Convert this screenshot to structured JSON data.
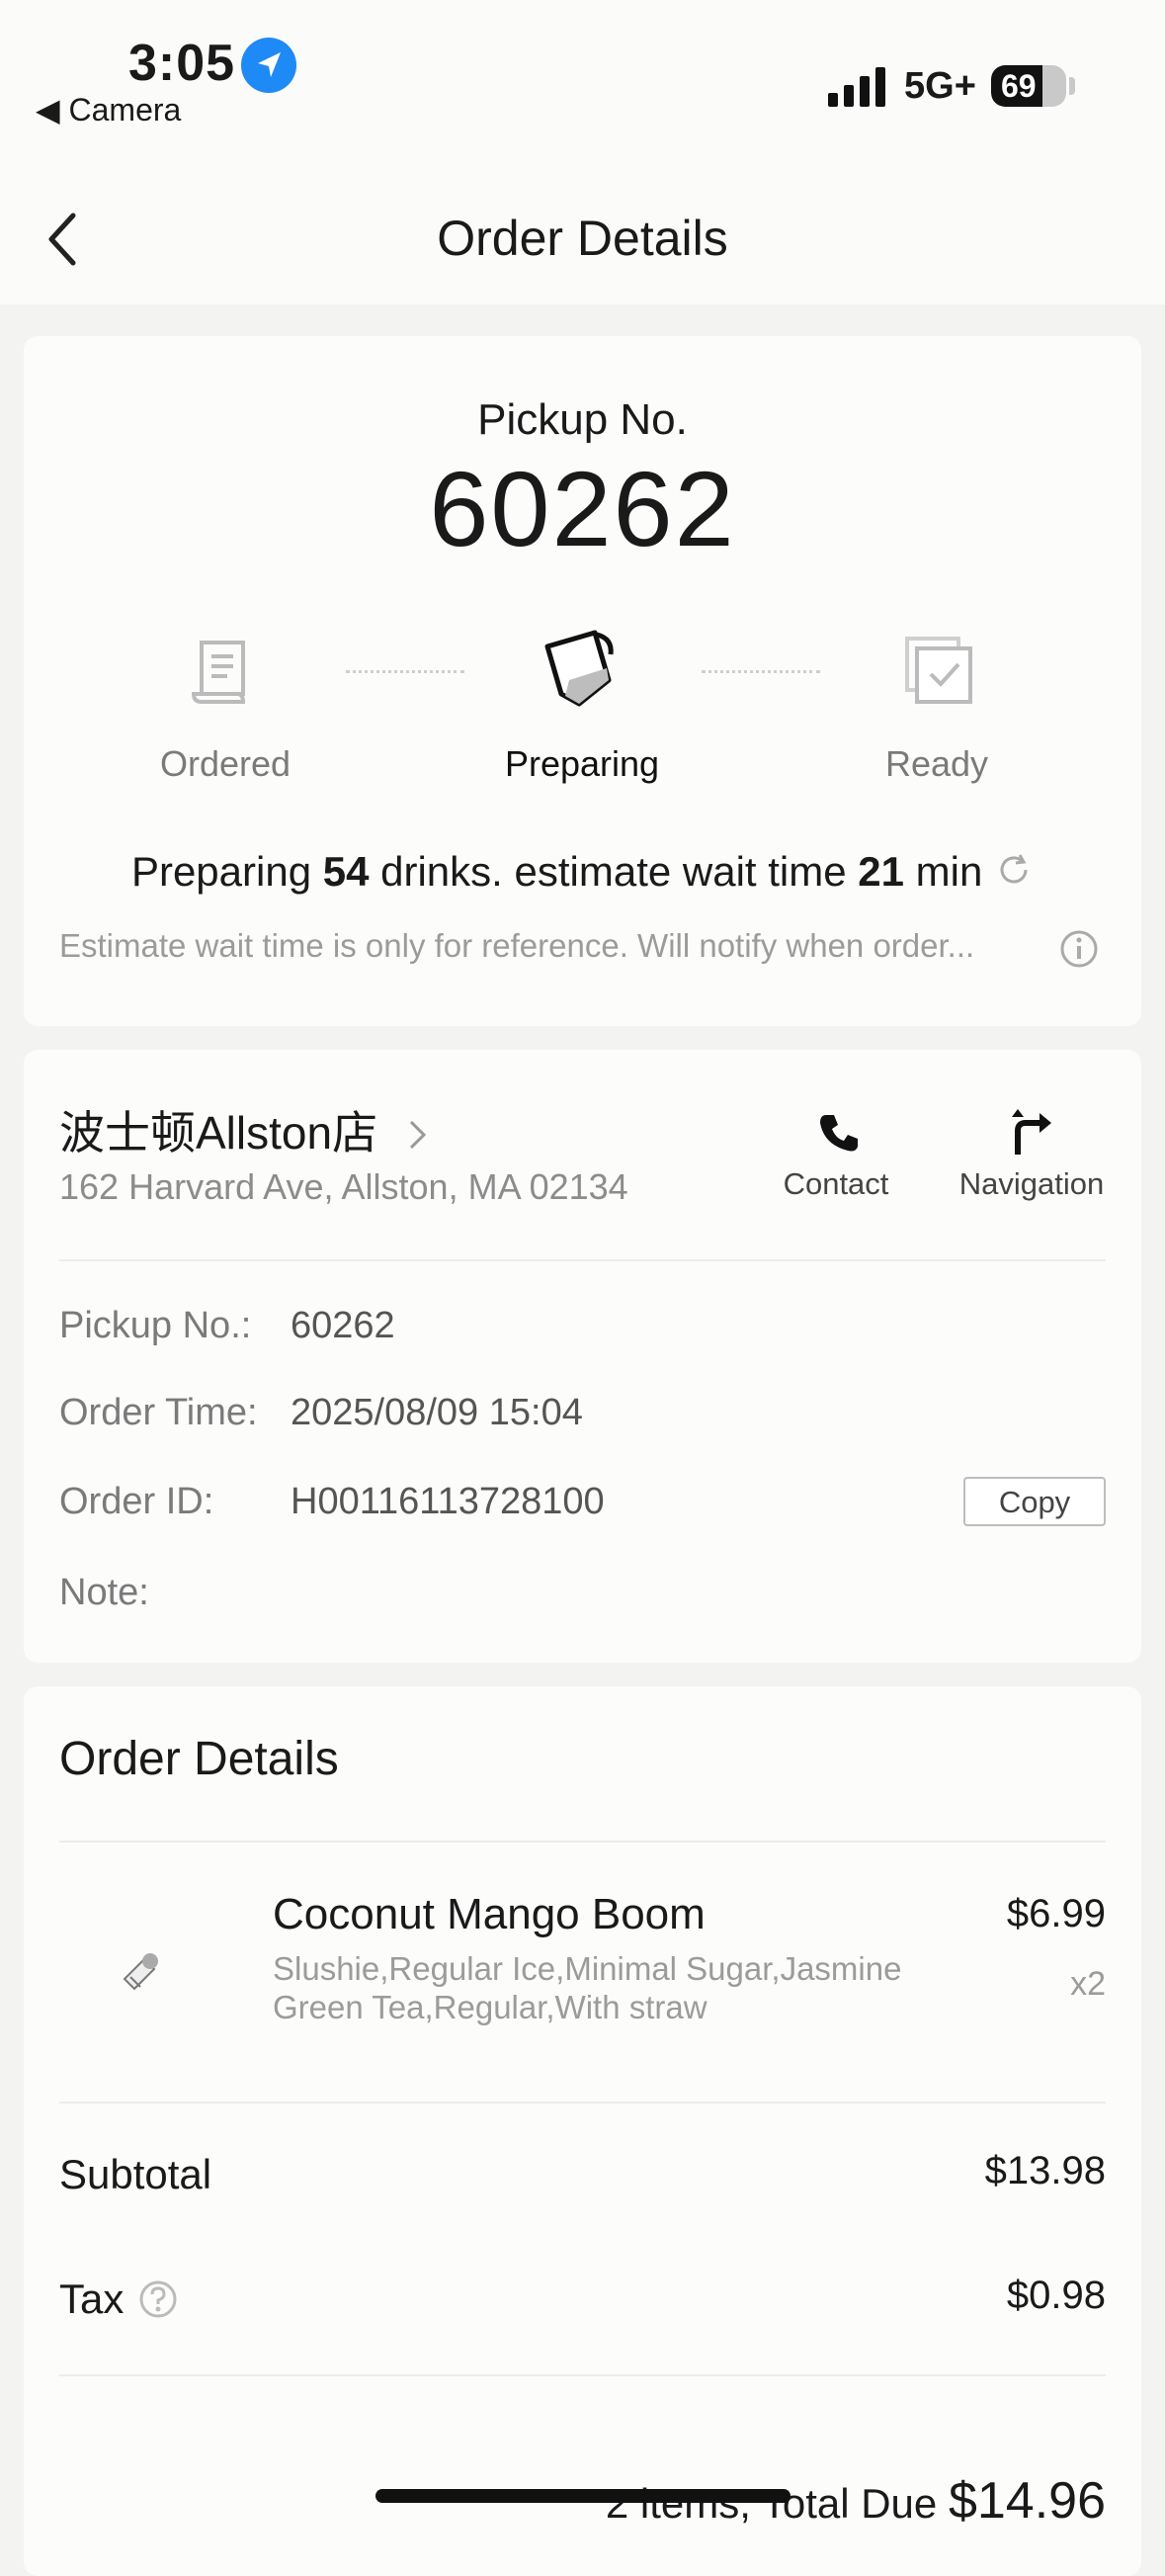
{
  "status_bar": {
    "time": "3:05",
    "back_app": "◀ Camera",
    "network": "5G+",
    "battery": "69",
    "battery_level": 0.69
  },
  "header": {
    "title": "Order Details"
  },
  "pickup": {
    "label": "Pickup No.",
    "number": "60262",
    "steps": [
      {
        "label": "Ordered",
        "icon": "receipt-icon",
        "active": false
      },
      {
        "label": "Preparing",
        "icon": "cup-pouring-icon",
        "active": true
      },
      {
        "label": "Ready",
        "icon": "checkbox-icon",
        "active": false
      }
    ],
    "status_prefix": "Preparing",
    "drinks_count": "54",
    "status_middle": "drinks. estimate wait time",
    "wait_minutes": "21",
    "status_suffix": "min",
    "notice": "Estimate wait time is only for reference. Will notify when order..."
  },
  "store": {
    "name": "波士顿Allston店",
    "address": "162 Harvard Ave, Allston, MA 02134",
    "contact_label": "Contact",
    "navigation_label": "Navigation",
    "pickup_no_label": "Pickup No.:",
    "pickup_no_value": "60262",
    "order_time_label": "Order Time:",
    "order_time_value": "2025/08/09 15:04",
    "order_id_label": "Order ID:",
    "order_id_value": "H00116113728100",
    "copy_label": "Copy",
    "note_label": "Note:"
  },
  "order": {
    "title": "Order Details",
    "item": {
      "name": "Coconut Mango Boom",
      "options": "Slushie,Regular Ice,Minimal Sugar,Jasmine Green Tea,Regular,With straw",
      "price": "$6.99",
      "qty": "x2"
    },
    "subtotal_label": "Subtotal",
    "subtotal_value": "$13.98",
    "tax_label": "Tax",
    "tax_value": "$0.98",
    "total_prefix": "2 items, Total Due",
    "total_value": "$14.96"
  },
  "colors": {
    "accent_blue": "#1e8af5",
    "background": "#f3f3f1",
    "card": "#fcfcfb"
  }
}
